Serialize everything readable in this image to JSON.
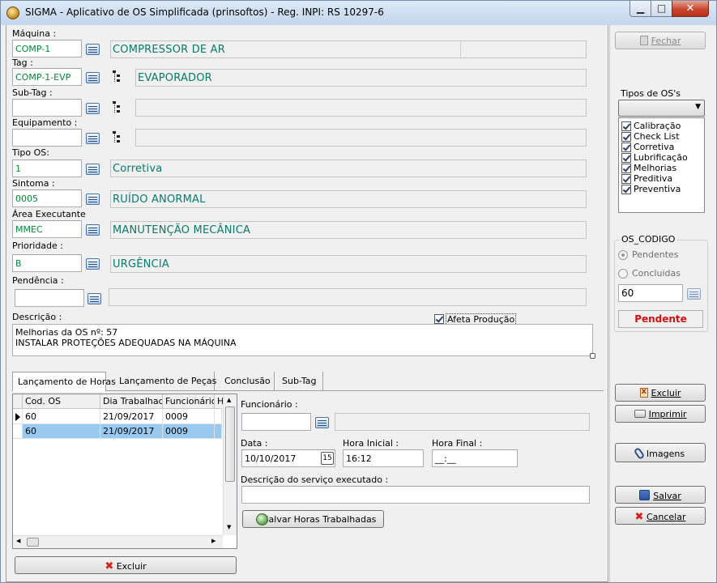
{
  "window": {
    "title": "SIGMA - Aplicativo de OS Simplificada (prinsoftos) - Reg. INPI: RS 10297-6"
  },
  "form": {
    "maquina": {
      "label": "Máquina :",
      "code": "COMP-1",
      "desc": "COMPRESSOR DE AR"
    },
    "tag": {
      "label": "Tag :",
      "code": "COMP-1-EVP",
      "desc": "EVAPORADOR"
    },
    "subtag": {
      "label": "Sub-Tag :",
      "code": "",
      "desc": ""
    },
    "equipamento": {
      "label": "Equipamento :",
      "code": "",
      "desc": ""
    },
    "tipo_os": {
      "label": "Tipo OS:",
      "code": "1",
      "desc": "Corretiva"
    },
    "sintoma": {
      "label": "Sintoma :",
      "code": "0005",
      "desc": "RUÍDO ANORMAL"
    },
    "area": {
      "label": "Área Executante",
      "code": "MMEC",
      "desc": "MANUTENÇÃO MECÂNICA"
    },
    "prioridade": {
      "label": "Prioridade :",
      "code": "B",
      "desc": "URGÊNCIA"
    },
    "pendencia": {
      "label": "Pendência :",
      "code": "",
      "desc": ""
    },
    "descricao": {
      "label": "Descrição :",
      "lines": [
        "Melhorias da OS nº: 57",
        "INSTALAR PROTEÇÕES ADEQUADAS NA MÁQUINA"
      ]
    },
    "afeta_producao": {
      "label": "Afeta Produção",
      "checked": true
    }
  },
  "tabs": [
    {
      "label": "Lançamento de Horas",
      "active": true
    },
    {
      "label": "Lançamento de Peças",
      "active": false
    },
    {
      "label": "Conclusão",
      "active": false
    },
    {
      "label": "Sub-Tag",
      "active": false
    }
  ],
  "grid": {
    "columns": [
      "Cod. OS",
      "Dia Trabalhado",
      "Funcionário",
      "H"
    ],
    "rows": [
      {
        "cod_os": "60",
        "dia": "21/09/2017",
        "func": "0009",
        "current": true,
        "selected": false
      },
      {
        "cod_os": "60",
        "dia": "21/09/2017",
        "func": "0009",
        "current": false,
        "selected": true
      }
    ]
  },
  "horas": {
    "funcionario_label": "Funcionário :",
    "funcionario_value": "",
    "data_label": "Data :",
    "data_value": "10/10/2017",
    "calendar_day": "15",
    "hora_inicial_label": "Hora Inicial :",
    "hora_inicial_value": "16:12",
    "hora_final_label": "Hora Final :",
    "hora_final_value": "__:__",
    "servico_label": "Descrição do serviço executado :",
    "servico_value": "",
    "salvar_horas_button": "Salvar Horas Trabalhadas",
    "excluir_button": "Excluir"
  },
  "sidebar": {
    "fechar_button": "Fechar",
    "tipos_label": "Tipos de OS's",
    "tipos_select_value": "",
    "tipos": [
      {
        "label": "Calibração",
        "checked": true
      },
      {
        "label": "Check List",
        "checked": true
      },
      {
        "label": "Corretiva",
        "checked": true
      },
      {
        "label": "Lubrificação",
        "checked": true
      },
      {
        "label": "Melhorias",
        "checked": true
      },
      {
        "label": "Preditiva",
        "checked": true
      },
      {
        "label": "Preventiva",
        "checked": true
      }
    ],
    "os_codigo_label": "OS_CODIGO",
    "pendentes_label": "Pendentes",
    "concluidas_label": "Concluidas",
    "os_codigo_value": "60",
    "status": "Pendente",
    "status_color": "#d01010",
    "excluir_button": "Excluir",
    "imprimir_button": "Imprimir",
    "imagens_button": "Imagens",
    "salvar_button": "Salvar",
    "cancelar_button": "Cancelar"
  }
}
